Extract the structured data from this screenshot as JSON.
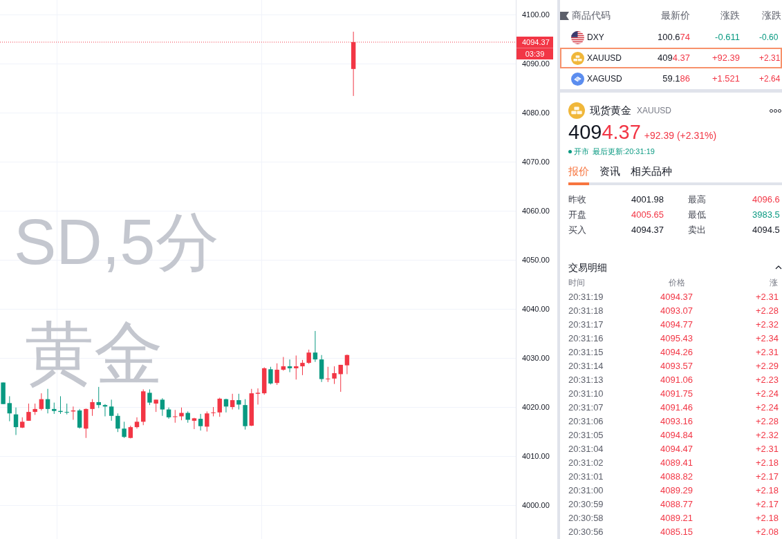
{
  "chart": {
    "watermark": [
      "SD,5分",
      "黄金"
    ],
    "countdown": "03:39",
    "chart_data": [
      {
        "type": "candlestick",
        "grid": true,
        "ylim": [
          3993.1,
          4102.96
        ],
        "categories": [
          null,
          null,
          null,
          null,
          null,
          null,
          null,
          null,
          null,
          null,
          null,
          null,
          null,
          null,
          null,
          null,
          null,
          null,
          null,
          null,
          null,
          null,
          null,
          null,
          null,
          null,
          null,
          null,
          null,
          null,
          null,
          null,
          null,
          null,
          null,
          null,
          null,
          null,
          null,
          null,
          null,
          null,
          null,
          null,
          null,
          null,
          null,
          null,
          null,
          null,
          null,
          null,
          null,
          null,
          null,
          null,
          null,
          null,
          null,
          null,
          null,
          null,
          null,
          null,
          null,
          null,
          null,
          null,
          null,
          null,
          null,
          null,
          null,
          null,
          null,
          null,
          null,
          null,
          null,
          null,
          null
        ],
        "yticks": [
          {
            "value": 4100,
            "label": "4100.00"
          },
          {
            "value": 4090,
            "label": "4090.00"
          },
          {
            "value": 4080,
            "label": "4080.00"
          },
          {
            "value": 4070,
            "label": "4070.00"
          },
          {
            "value": 4060,
            "label": "4060.00"
          },
          {
            "value": 4050,
            "label": "4050.00"
          },
          {
            "value": 4040,
            "label": "4040.00"
          },
          {
            "value": 4030,
            "label": "4030.00"
          },
          {
            "value": 4020,
            "label": "4020.00"
          },
          {
            "value": 4010,
            "label": "4010.00"
          },
          {
            "value": 4000,
            "label": "4000.00"
          }
        ],
        "ref_lines": [
          {
            "axis": "y",
            "value": 4094.37,
            "label": "4094.37",
            "color": "#f23645",
            "line_style": "dotted"
          }
        ],
        "ohlc": [
          [
            4025.0,
            4025.0,
            4020.6,
            4020.6
          ],
          [
            4020.8,
            4022.2,
            4017.1,
            4018.7
          ],
          [
            4018.5,
            4019.9,
            4014.3,
            4015.9
          ],
          [
            4015.8,
            4017.9,
            4015.7,
            4017.0
          ],
          [
            4017.2,
            4020.7,
            4017.2,
            4019.0
          ],
          [
            4019.0,
            4020.7,
            4018.4,
            4019.6
          ],
          [
            4019.6,
            4022.8,
            4019.3,
            4021.6
          ],
          [
            4021.6,
            4023.7,
            4018.7,
            4019.6
          ],
          [
            4019.6,
            4020.9,
            4018.6,
            4019.2
          ],
          [
            4019.2,
            4022.2,
            4018.6,
            4019.0
          ],
          [
            4019.0,
            4020.7,
            4018.5,
            4018.9
          ],
          [
            4019.1,
            4020.1,
            4017.4,
            4019.3
          ],
          [
            4019.3,
            4019.6,
            4015.6,
            4015.8
          ],
          [
            4015.6,
            4019.7,
            4013.7,
            4019.6
          ],
          [
            4019.6,
            4021.6,
            4018.2,
            4021.0
          ],
          [
            4021.0,
            4024.1,
            4019.8,
            4020.4
          ],
          [
            4020.4,
            4020.6,
            4018.1,
            4020.1
          ],
          [
            4020.1,
            4021.5,
            4017.2,
            4018.2
          ],
          [
            4018.2,
            4018.7,
            4014.9,
            4015.6
          ],
          [
            4015.6,
            4017.0,
            4013.7,
            4013.9
          ],
          [
            4013.7,
            4016.2,
            4013.6,
            4015.9
          ],
          [
            4015.9,
            4017.9,
            4015.6,
            4017.0
          ],
          [
            4017.0,
            4023.6,
            4016.3,
            4023.2
          ],
          [
            4022.9,
            4023.6,
            4020.4,
            4020.9
          ],
          [
            4020.7,
            4021.5,
            4019.0,
            4021.5
          ],
          [
            4021.5,
            4021.8,
            4018.2,
            4019.5
          ],
          [
            4019.5,
            4019.9,
            4017.6,
            4017.9
          ],
          [
            4018.0,
            4019.4,
            4016.8,
            4018.1
          ],
          [
            4018.1,
            4019.9,
            4017.3,
            4018.8
          ],
          [
            4018.8,
            4019.1,
            4016.8,
            4017.4
          ],
          [
            4017.2,
            4017.8,
            4015.5,
            4017.7
          ],
          [
            4017.6,
            4018.6,
            4015.2,
            4016.1
          ],
          [
            4016.0,
            4019.1,
            4015.0,
            4018.7
          ],
          [
            4018.8,
            4020.0,
            4018.1,
            4018.9
          ],
          [
            4018.9,
            4021.9,
            4018.0,
            4021.7
          ],
          [
            4021.6,
            4021.7,
            4018.9,
            4020.1
          ],
          [
            4020.0,
            4022.7,
            4019.5,
            4021.4
          ],
          [
            4021.4,
            4022.7,
            4019.5,
            4020.5
          ],
          [
            4020.4,
            4021.6,
            4015.4,
            4016.1
          ],
          [
            4016.2,
            4023.7,
            4016.1,
            4022.8
          ],
          [
            4022.7,
            4023.8,
            4020.5,
            4022.9
          ],
          [
            4022.8,
            4028.1,
            4022.5,
            4027.9
          ],
          [
            4027.7,
            4028.2,
            4024.6,
            4024.8
          ],
          [
            4024.9,
            4028.9,
            4024.5,
            4027.6
          ],
          [
            4027.6,
            4030.2,
            4027.4,
            4028.3
          ],
          [
            4028.3,
            4029.7,
            4027.1,
            4027.9
          ],
          [
            4027.9,
            4030.5,
            4025.6,
            4028.3
          ],
          [
            4028.3,
            4029.6,
            4026.5,
            4029.0
          ],
          [
            4029.0,
            4031.7,
            4028.8,
            4031.1
          ],
          [
            4031.1,
            4035.5,
            4029.2,
            4029.7
          ],
          [
            4029.7,
            4030.6,
            4025.1,
            4025.7
          ],
          [
            4025.7,
            4028.2,
            4025.1,
            4025.8
          ],
          [
            4025.8,
            4028.3,
            4024.7,
            4026.9
          ],
          [
            4026.7,
            4028.6,
            4023.1,
            4028.6
          ],
          [
            4028.5,
            4030.7,
            4026.7,
            4030.6
          ],
          [
            4088.9,
            4096.5,
            4083.4,
            4094.37
          ],
          null,
          null,
          null,
          null,
          null,
          null,
          null,
          null,
          null,
          null,
          null,
          null,
          null,
          null,
          null,
          null,
          null,
          null,
          null,
          null,
          null,
          null,
          null,
          null,
          null
        ]
      }
    ]
  },
  "watchlist": {
    "columns": [
      "商品代码",
      "最新价",
      "涨跌",
      "涨跌"
    ],
    "rows": [
      {
        "kind": "flag",
        "symbol": "DXY",
        "price": {
          "unchanged": "100.6",
          "changed": "74",
          "color": "#f23645"
        },
        "change": {
          "text": "-0.611",
          "color": "#089981"
        },
        "change_pct": {
          "text": "-0.60",
          "color": "#089981"
        },
        "selected": false
      },
      {
        "kind": "gold",
        "symbol": "XAUUSD",
        "price": {
          "unchanged": "409",
          "changed": "4.37",
          "color": "#f23645"
        },
        "change": {
          "text": "+92.39",
          "color": "#f23645"
        },
        "change_pct": {
          "text": "+2.31",
          "color": "#f23645"
        },
        "selected": true
      },
      {
        "kind": "silver",
        "symbol": "XAGUSD",
        "price": {
          "unchanged": "59.1",
          "changed": "86",
          "color": "#f23645"
        },
        "change": {
          "text": "+1.521",
          "color": "#f23645"
        },
        "change_pct": {
          "text": "+2.64",
          "color": "#f23645"
        },
        "selected": false
      }
    ]
  },
  "detail": {
    "kind": "gold",
    "name": "现货黄金",
    "symbol": "XAUUSD",
    "price": {
      "unchanged": "409",
      "changed": "4.37",
      "color": "#f23645"
    },
    "change": {
      "text": "+92.39 (+2.31%)",
      "color": "#f23645"
    },
    "status": "开市",
    "updated": "最后更新:20:31:19",
    "tabs": [
      {
        "label": "报价",
        "selected": true
      },
      {
        "label": "资讯",
        "selected": false
      },
      {
        "label": "相关品种",
        "selected": false
      }
    ],
    "stats": [
      {
        "label": "昨收",
        "value": "4001.98",
        "color": "#131722"
      },
      {
        "label": "最高",
        "value": "4096.6",
        "color": "#f23645"
      },
      {
        "label": "开盘",
        "value": "4005.65",
        "color": "#f23645"
      },
      {
        "label": "最低",
        "value": "3983.5",
        "color": "#089981"
      },
      {
        "label": "买入",
        "value": "4094.37",
        "color": "#131722"
      },
      {
        "label": "卖出",
        "value": "4094.5",
        "color": "#131722"
      }
    ]
  },
  "trades": {
    "title": "交易明细",
    "expanded": true,
    "columns": [
      "时间",
      "价格",
      "涨"
    ],
    "rows": [
      {
        "time": "20:31:19",
        "price": "4094.37",
        "change": "+2.31",
        "color": "#f23645"
      },
      {
        "time": "20:31:18",
        "price": "4093.07",
        "change": "+2.28",
        "color": "#f23645"
      },
      {
        "time": "20:31:17",
        "price": "4094.77",
        "change": "+2.32",
        "color": "#f23645"
      },
      {
        "time": "20:31:16",
        "price": "4095.43",
        "change": "+2.34",
        "color": "#f23645"
      },
      {
        "time": "20:31:15",
        "price": "4094.26",
        "change": "+2.31",
        "color": "#f23645"
      },
      {
        "time": "20:31:14",
        "price": "4093.57",
        "change": "+2.29",
        "color": "#f23645"
      },
      {
        "time": "20:31:13",
        "price": "4091.06",
        "change": "+2.23",
        "color": "#f23645"
      },
      {
        "time": "20:31:10",
        "price": "4091.75",
        "change": "+2.24",
        "color": "#f23645"
      },
      {
        "time": "20:31:07",
        "price": "4091.46",
        "change": "+2.24",
        "color": "#f23645"
      },
      {
        "time": "20:31:06",
        "price": "4093.16",
        "change": "+2.28",
        "color": "#f23645"
      },
      {
        "time": "20:31:05",
        "price": "4094.84",
        "change": "+2.32",
        "color": "#f23645"
      },
      {
        "time": "20:31:04",
        "price": "4094.47",
        "change": "+2.31",
        "color": "#f23645"
      },
      {
        "time": "20:31:02",
        "price": "4089.41",
        "change": "+2.18",
        "color": "#f23645"
      },
      {
        "time": "20:31:01",
        "price": "4088.82",
        "change": "+2.17",
        "color": "#f23645"
      },
      {
        "time": "20:31:00",
        "price": "4089.29",
        "change": "+2.18",
        "color": "#f23645"
      },
      {
        "time": "20:30:59",
        "price": "4088.77",
        "change": "+2.17",
        "color": "#f23645"
      },
      {
        "time": "20:30:58",
        "price": "4089.21",
        "change": "+2.18",
        "color": "#f23645"
      },
      {
        "time": "20:30:56",
        "price": "4085.15",
        "change": "+2.08",
        "color": "#f23645"
      }
    ]
  }
}
